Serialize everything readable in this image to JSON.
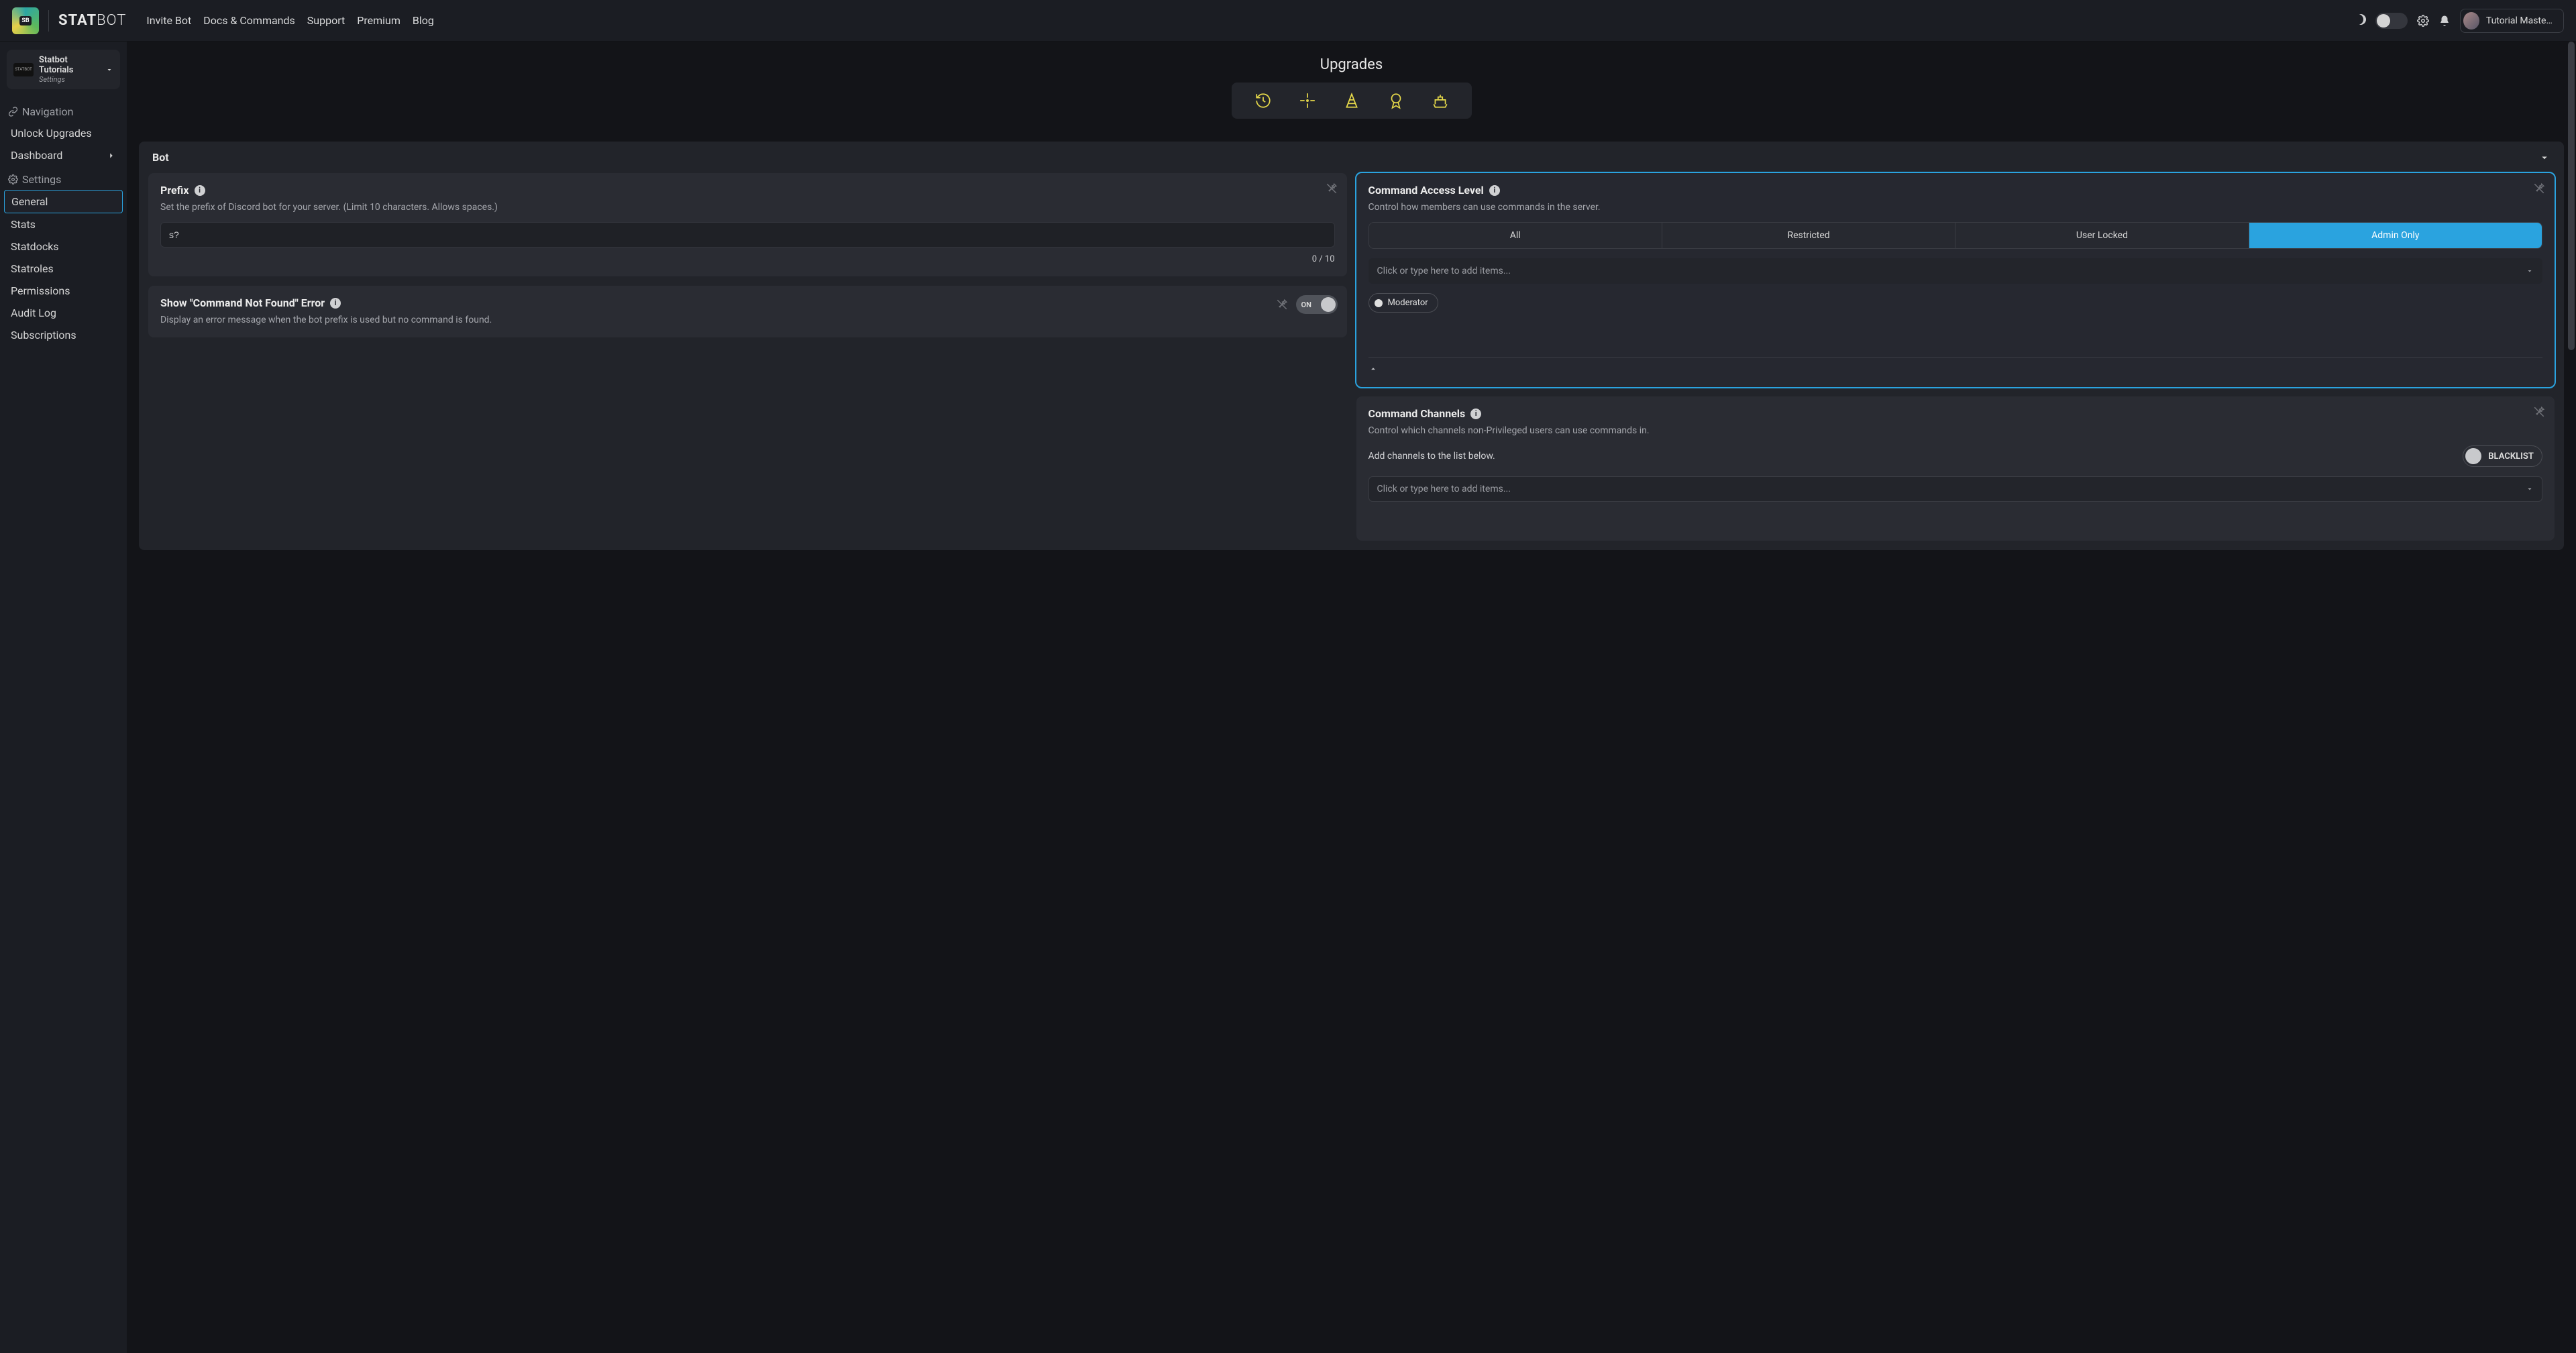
{
  "brand": {
    "bold": "STAT",
    "light": "BOT"
  },
  "nav": {
    "links": [
      "Invite Bot",
      "Docs & Commands",
      "Support",
      "Premium",
      "Blog"
    ],
    "user": "Tutorial Master#…"
  },
  "sidebar": {
    "server": {
      "name": "Statbot Tutorials",
      "sub": "Settings"
    },
    "navigation": {
      "header": "Navigation",
      "items": [
        "Unlock Upgrades",
        "Dashboard"
      ]
    },
    "settings": {
      "header": "Settings",
      "items": [
        "General",
        "Stats",
        "Statdocks",
        "Statroles",
        "Permissions",
        "Audit Log",
        "Subscriptions"
      ],
      "active": "General"
    }
  },
  "upgrades": {
    "title": "Upgrades"
  },
  "panel": {
    "title": "Bot"
  },
  "cards": {
    "prefix": {
      "title": "Prefix",
      "desc": "Set the prefix of Discord bot for your server. (Limit 10 characters. Allows spaces.)",
      "value": "s?",
      "counter": "0 / 10"
    },
    "cmdnotfound": {
      "title": "Show \"Command Not Found\" Error",
      "desc": "Display an error message when the bot prefix is used but no command is found.",
      "toggle": "ON"
    },
    "access": {
      "title": "Command Access Level",
      "desc": "Control how members can use commands in the server.",
      "options": [
        "All",
        "Restricted",
        "User Locked",
        "Admin Only"
      ],
      "active": "Admin Only",
      "combo_placeholder": "Click or type here to add items...",
      "chip": "Moderator"
    },
    "channels": {
      "title": "Command Channels",
      "desc": "Control which channels non-Privileged users can use commands in.",
      "subline": "Add channels to the list below.",
      "mode": "BLACKLIST",
      "combo_placeholder": "Click or type here to add items..."
    }
  }
}
